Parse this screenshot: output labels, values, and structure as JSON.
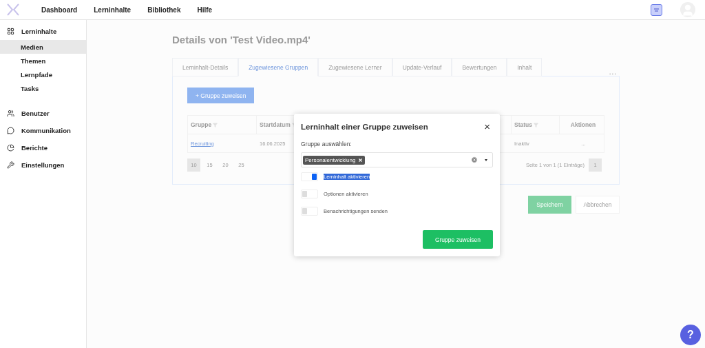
{
  "header": {
    "nav": [
      {
        "label": "Dashboard"
      },
      {
        "label": "Lerninhalte"
      },
      {
        "label": "Bibliothek"
      },
      {
        "label": "Hilfe"
      }
    ]
  },
  "sidebar": {
    "items": [
      {
        "label": "Lerninhalte",
        "selected": false,
        "children": [
          {
            "label": "Medien",
            "selected": true
          },
          {
            "label": "Themen",
            "selected": false
          },
          {
            "label": "Lernpfade",
            "selected": false
          },
          {
            "label": "Tasks",
            "selected": false
          }
        ]
      },
      {
        "label": "Benutzer",
        "selected": false
      },
      {
        "label": "Kommunikation",
        "selected": false
      },
      {
        "label": "Berichte",
        "selected": false
      },
      {
        "label": "Einstellungen",
        "selected": false
      }
    ]
  },
  "page": {
    "title": "Details von 'Test Video.mp4'",
    "tabs": [
      {
        "label": "Lerninhalt-Details",
        "selected": false
      },
      {
        "label": "Zugewiesene Gruppen",
        "selected": true
      },
      {
        "label": "Zugewiesene Lerner",
        "selected": false
      },
      {
        "label": "Update-Verlauf",
        "selected": false
      },
      {
        "label": "Bewertungen",
        "selected": false
      },
      {
        "label": "Inhalt",
        "selected": false
      }
    ],
    "more": "...",
    "add_button": "+ Gruppe zuweisen",
    "table": {
      "columns": [
        "Gruppe",
        "Startdatum",
        "",
        "Status",
        "Aktionen"
      ],
      "rows": [
        {
          "group": "Recruiting",
          "start": "16.06.2025",
          "status": "Inaktiv",
          "actions": "..."
        }
      ]
    },
    "page_sizes": [
      {
        "label": "10",
        "selected": true
      },
      {
        "label": "15",
        "selected": false
      },
      {
        "label": "20",
        "selected": false
      },
      {
        "label": "25",
        "selected": false
      }
    ],
    "page_info": "Seite 1 von 1 (1 Einträge)",
    "pages": [
      {
        "label": "1",
        "selected": true
      }
    ],
    "save": "Speichern",
    "cancel": "Abbrechen"
  },
  "dialog": {
    "title": "Lerninhalt einer Gruppe zuweisen",
    "close": "×",
    "select_label": "Gruppe auswählen:",
    "tags": [
      {
        "label": "Personalentwicklung"
      }
    ],
    "toggles": [
      {
        "label": "Lerninhalt aktivieren",
        "on": true,
        "highlighted": true
      },
      {
        "label": "Optionen aktivieren",
        "on": false,
        "highlighted": false
      },
      {
        "label": "Benachrichtigungen senden",
        "on": false,
        "highlighted": false
      }
    ],
    "submit": "Gruppe zuweisen"
  },
  "help": "?"
}
